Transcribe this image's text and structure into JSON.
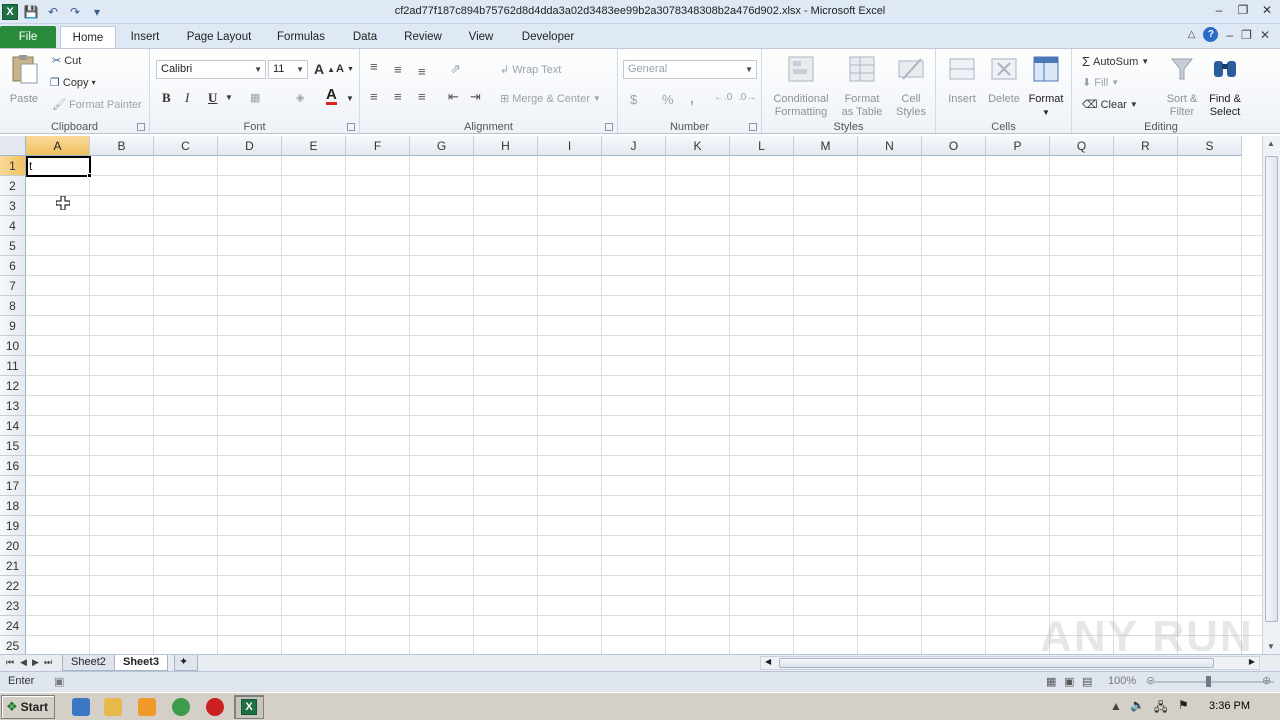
{
  "window": {
    "title": "cf2ad77f187c894b75762d8d4dda3a02d3483ee99b2a3078348308b2a476d902.xlsx - Microsoft Excel"
  },
  "tabs": [
    "File",
    "Home",
    "Insert",
    "Page Layout",
    "Formulas",
    "Data",
    "Review",
    "View",
    "Developer"
  ],
  "ribbon": {
    "clipboard": {
      "label": "Clipboard",
      "paste": "Paste",
      "cut": "Cut",
      "copy": "Copy",
      "format_painter": "Format Painter"
    },
    "font": {
      "label": "Font",
      "name": "Calibri",
      "size": "11",
      "bold": "B",
      "italic": "I",
      "underline": "U",
      "font_color": "A"
    },
    "alignment": {
      "label": "Alignment",
      "wrap_text": "Wrap Text",
      "merge_center": "Merge & Center"
    },
    "number": {
      "label": "Number",
      "format": "General",
      "currency": "$",
      "percent": "%",
      "comma": ","
    },
    "styles": {
      "label": "Styles",
      "conditional_1": "Conditional",
      "conditional_2": "Formatting",
      "format_table_1": "Format",
      "format_table_2": "as Table",
      "cell_styles_1": "Cell",
      "cell_styles_2": "Styles"
    },
    "cells": {
      "label": "Cells",
      "insert": "Insert",
      "delete": "Delete",
      "format": "Format"
    },
    "editing": {
      "label": "Editing",
      "autosum": "AutoSum",
      "fill": "Fill",
      "clear": "Clear",
      "sort_1": "Sort &",
      "sort_2": "Filter",
      "find_1": "Find &",
      "find_2": "Select"
    }
  },
  "grid": {
    "columns": [
      "A",
      "B",
      "C",
      "D",
      "E",
      "F",
      "G",
      "H",
      "I",
      "J",
      "K",
      "L",
      "M",
      "N",
      "O",
      "P",
      "Q",
      "R",
      "S"
    ],
    "rows": [
      "1",
      "2",
      "3",
      "4",
      "5",
      "6",
      "7",
      "8",
      "9",
      "10",
      "11",
      "12",
      "13",
      "14",
      "15",
      "16",
      "17",
      "18",
      "19",
      "20",
      "21",
      "22",
      "23",
      "24",
      "25"
    ],
    "active_cell": "A1",
    "active_cell_text": "t"
  },
  "sheets": {
    "tabs": [
      "Sheet2",
      "Sheet3"
    ],
    "active": "Sheet3"
  },
  "statusbar": {
    "mode": "Enter",
    "zoom": "100%"
  },
  "taskbar": {
    "start": "Start",
    "clock": "3:36 PM"
  },
  "watermark": "ANY RUN",
  "colors": {
    "file_tab": "#2a8a3c",
    "selected_header": "#f1c15f",
    "ribbon_bg": "#eef2f7"
  }
}
